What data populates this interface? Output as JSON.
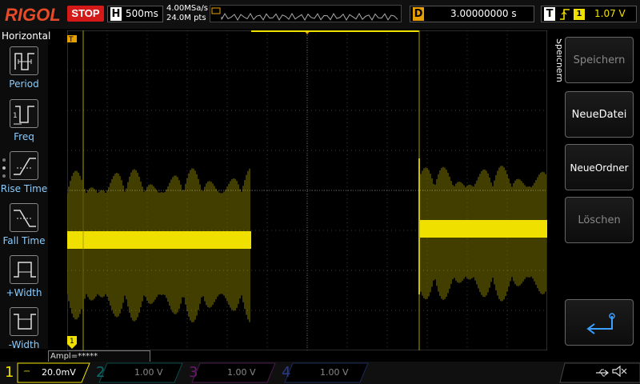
{
  "brand": "RIGOL",
  "run_state": "STOP",
  "horizontal": {
    "label": "H",
    "timebase": "500ms",
    "sample_rate": "4.00MSa/s",
    "points": "24.0M pts"
  },
  "delay": {
    "label": "D",
    "value": "3.00000000 s"
  },
  "trigger": {
    "label": "T",
    "edge": "rising",
    "edge_glyph": "⨍",
    "channel": "1",
    "level": "1.07 V"
  },
  "left_menu": {
    "title": "Horizontal",
    "items": [
      {
        "label": "Period",
        "icon": "period-icon"
      },
      {
        "label": "Freq",
        "icon": "frequency-icon"
      },
      {
        "label": "Rise Time",
        "icon": "rise-time-icon"
      },
      {
        "label": "Fall Time",
        "icon": "fall-time-icon"
      },
      {
        "label": "+Width",
        "icon": "positive-width-icon"
      },
      {
        "label": "-Width",
        "icon": "negative-width-icon"
      }
    ]
  },
  "right_menu": {
    "title": "Speichern",
    "items": [
      {
        "label": "Speichern",
        "enabled": false
      },
      {
        "label": "NeueDatei",
        "enabled": true
      },
      {
        "label": "NeueOrdner",
        "enabled": true
      },
      {
        "label": "Löschen",
        "enabled": false
      },
      {
        "label": "",
        "icon": "return-arrow-icon",
        "enabled": true
      }
    ]
  },
  "measurement": {
    "label": "Ampl=*****"
  },
  "channels": [
    {
      "num": "1",
      "scale": "20.0mV",
      "color": "#f0e000",
      "active": true
    },
    {
      "num": "2",
      "scale": "1.00 V",
      "color": "#00c8c8",
      "active": false
    },
    {
      "num": "3",
      "scale": "1.00 V",
      "color": "#e040e0",
      "active": false
    },
    {
      "num": "4",
      "scale": "1.00 V",
      "color": "#2a6cff",
      "active": false
    }
  ],
  "status_icons": [
    "usb-icon",
    "speaker-muted-icon"
  ],
  "colors": {
    "trace": "#f0e000",
    "accent": "#e84a28",
    "trigger_orange": "#e8a000",
    "menu_text": "#88ccff"
  }
}
